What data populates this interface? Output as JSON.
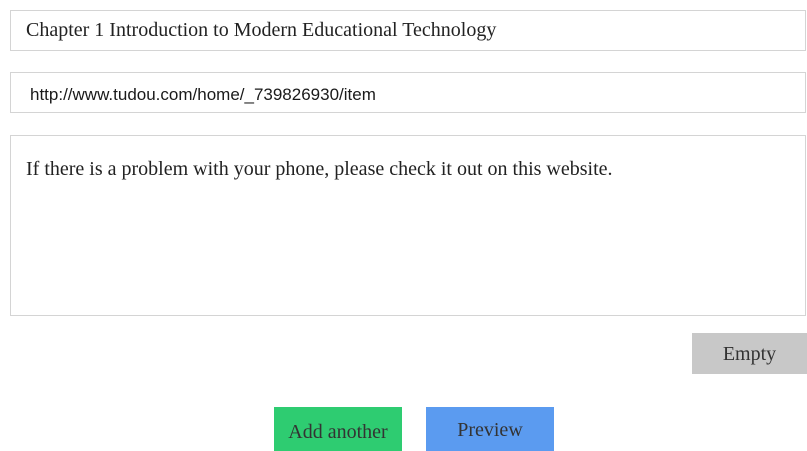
{
  "form": {
    "title_value": "Chapter 1 Introduction to Modern Educational Technology",
    "url_value": "http://www.tudou.com/home/_739826930/item",
    "description_value": "If there is a problem with your phone, please check it out on this website."
  },
  "buttons": {
    "empty_label": "Empty",
    "add_another_label": "Add another",
    "preview_label": "Preview"
  },
  "colors": {
    "add_button": "#2ecc71",
    "preview_button": "#5b9bf0",
    "empty_button": "#c8c8c8",
    "field_border": "#d4d4d4"
  }
}
